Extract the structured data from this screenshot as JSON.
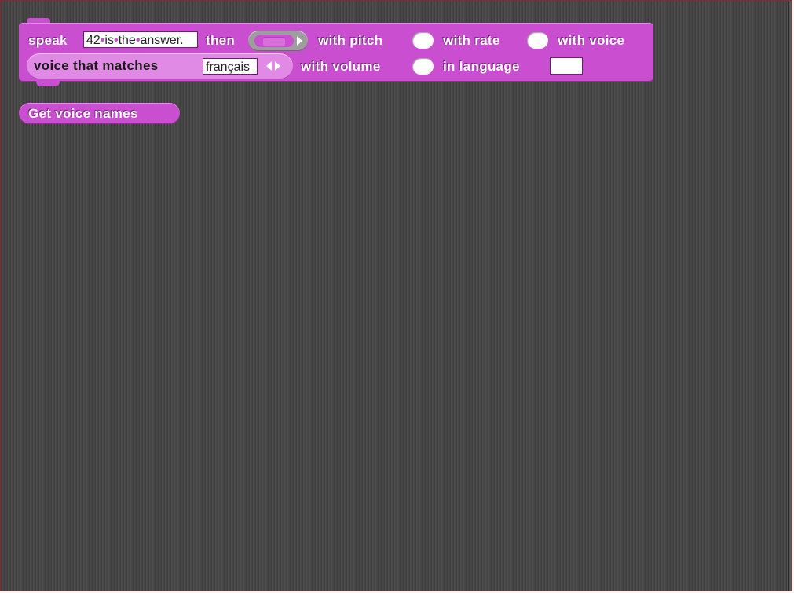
{
  "speak_block": {
    "speak_label": "speak",
    "text_part1": "42",
    "text_part2": "is",
    "text_part3": "the",
    "text_part4": "answer.",
    "then_label": "then",
    "with_pitch_label": "with pitch",
    "with_rate_label": "with rate",
    "with_voice_label": "with voice",
    "with_volume_label": "with volume",
    "in_language_label": "in language"
  },
  "voice_reporter": {
    "label": "voice that matches",
    "value": "français"
  },
  "get_voices_block": {
    "label": "Get voice names"
  },
  "colors": {
    "sound_block": "#c94fd0",
    "reporter_light": "#e08ae5",
    "ring": "#9d9d9d",
    "stage_background": "#464646"
  }
}
